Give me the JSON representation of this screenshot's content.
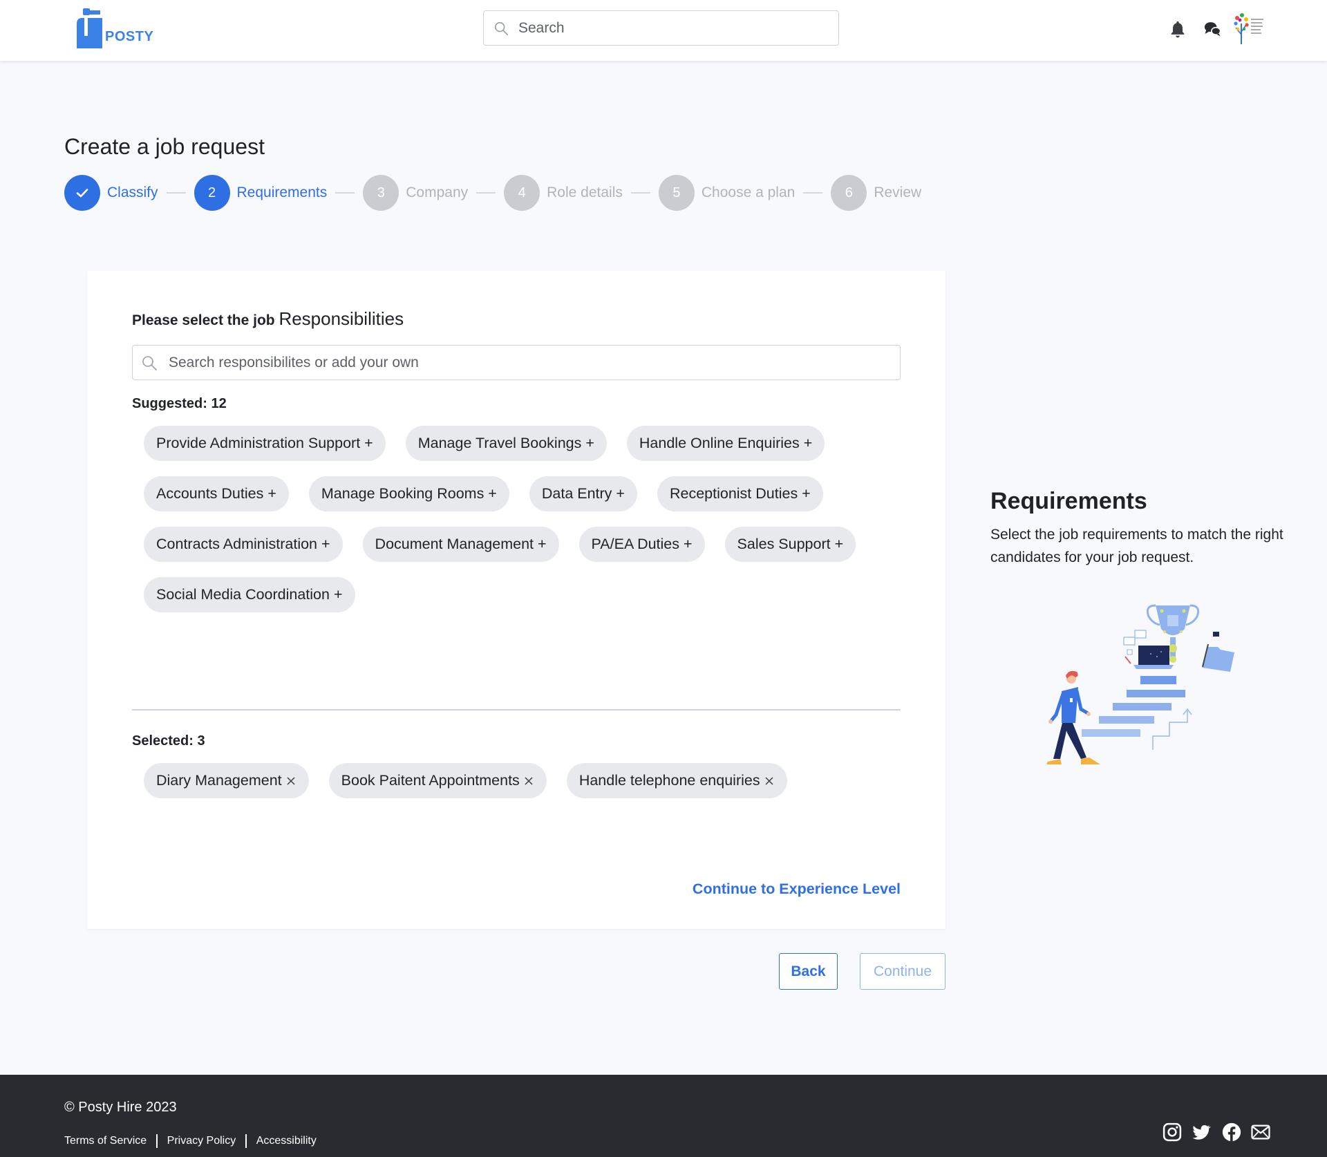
{
  "header": {
    "logo_text": "POSTY",
    "search_placeholder": "Search"
  },
  "page": {
    "title": "Create a job request"
  },
  "stepper": {
    "steps": [
      {
        "number": "1",
        "label": "Classify",
        "state": "done"
      },
      {
        "number": "2",
        "label": "Requirements",
        "state": "active"
      },
      {
        "number": "3",
        "label": "Company",
        "state": "todo"
      },
      {
        "number": "4",
        "label": "Role details",
        "state": "todo"
      },
      {
        "number": "5",
        "label": "Choose a plan",
        "state": "todo"
      },
      {
        "number": "6",
        "label": "Review",
        "state": "todo"
      }
    ]
  },
  "card": {
    "heading_prefix": "Please select the job ",
    "heading_main": "Responsibilities",
    "search_placeholder": "Search responsibilites or add your own",
    "suggested_label": "Suggested: 12",
    "suggested": [
      "Provide Administration Support +",
      "Manage Travel Bookings +",
      "Handle Online Enquiries +",
      "Accounts Duties +",
      "Manage Booking Rooms +",
      "Data Entry +",
      "Receptionist Duties +",
      "Contracts Administration +",
      "Document Management +",
      "PA/EA Duties +",
      "Sales Support +",
      "Social Media Coordination +"
    ],
    "selected_label": "Selected: 3",
    "selected": [
      "Diary Management",
      "Book Paitent Appointments",
      "Handle telephone enquiries"
    ],
    "continue_link": "Continue to Experience Level"
  },
  "buttons": {
    "back": "Back",
    "continue": "Continue"
  },
  "side": {
    "title": "Requirements",
    "text": "Select the job requirements to match the right candidates for your job request."
  },
  "footer": {
    "copyright": "© Posty Hire 2023",
    "links": [
      "Terms of Service",
      "Privacy Policy",
      "Accessibility"
    ]
  },
  "colors": {
    "accent": "#2f6fe4",
    "step_inactive": "#c9ccd1",
    "chip_bg": "#e8e9ec",
    "footer_bg": "#2a2b30"
  }
}
